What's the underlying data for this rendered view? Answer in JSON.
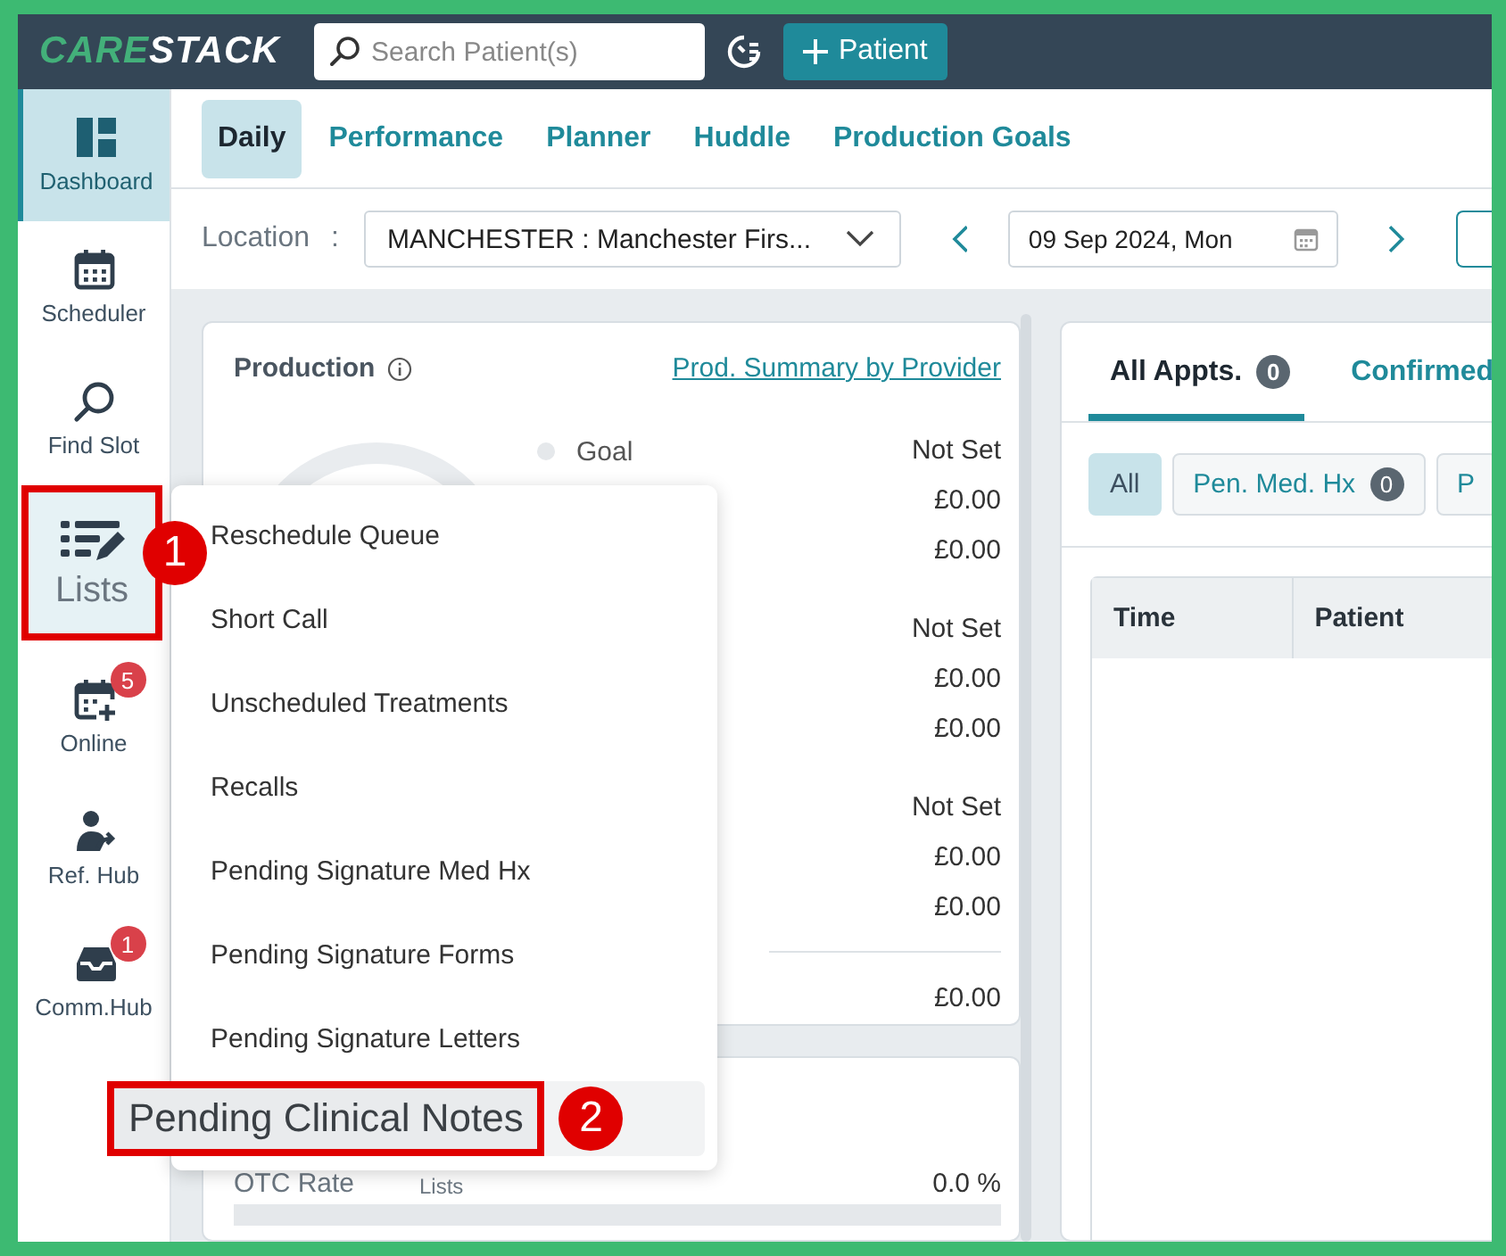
{
  "topbar": {
    "logo": [
      "CARE",
      "STACK"
    ],
    "search": {
      "placeholder": "Search Patient(s)"
    },
    "add_button": "Patient"
  },
  "sidebar": {
    "items": [
      {
        "label": "Dashboard",
        "selected": true
      },
      {
        "label": "Scheduler",
        "selected": false
      },
      {
        "label": "Find Slot",
        "selected": false
      },
      {
        "label": "Lists",
        "selected": false,
        "annotation": "1"
      },
      {
        "label": "Online",
        "selected": false,
        "badge": "5"
      },
      {
        "label": "Ref. Hub",
        "selected": false
      },
      {
        "label": "Comm.Hub",
        "selected": false,
        "badge": "1"
      }
    ]
  },
  "tabs": [
    {
      "label": "Daily",
      "selected": true
    },
    {
      "label": "Performance",
      "selected": false
    },
    {
      "label": "Planner",
      "selected": false
    },
    {
      "label": "Huddle",
      "selected": false
    },
    {
      "label": "Production Goals",
      "selected": false
    }
  ],
  "location": {
    "label": "Location",
    "separator": ":",
    "value": "MANCHESTER : Manchester Firs...",
    "date": "09 Sep 2024, Mon"
  },
  "production": {
    "title": "Production",
    "link": "Prod. Summary by Provider",
    "legend": [
      "Goal"
    ],
    "groups": [
      [
        "Not Set",
        "£0.00",
        "£0.00"
      ],
      [
        "Not Set",
        "£0.00",
        "£0.00"
      ],
      [
        "Not Set",
        "£0.00",
        "£0.00"
      ]
    ],
    "total": "£0.00"
  },
  "otc": {
    "label": "OTC Rate",
    "value": "0.0 %"
  },
  "appointments": {
    "tabs": [
      {
        "label": "All Appts.",
        "count": "0",
        "selected": true
      },
      {
        "label": "Confirmed",
        "selected": false
      }
    ],
    "filters": [
      {
        "label": "All",
        "selected": true
      },
      {
        "label": "Pen. Med. Hx",
        "count": "0",
        "selected": false
      },
      {
        "label": "P",
        "selected": false
      }
    ],
    "columns": [
      "Time",
      "Patient"
    ]
  },
  "lists_menu": {
    "items": [
      {
        "label": "Reschedule Queue",
        "selected": false
      },
      {
        "label": "Short Call",
        "selected": false
      },
      {
        "label": "Unscheduled Treatments",
        "selected": false
      },
      {
        "label": "Recalls",
        "selected": false
      },
      {
        "label": "Pending Signature Med Hx",
        "selected": false
      },
      {
        "label": "Pending Signature Forms",
        "selected": false
      },
      {
        "label": "Pending Signature Letters",
        "selected": false
      },
      {
        "label": "Pending Clinical Notes",
        "selected": true,
        "annotation": "2"
      }
    ],
    "tooltip": "Lists"
  }
}
